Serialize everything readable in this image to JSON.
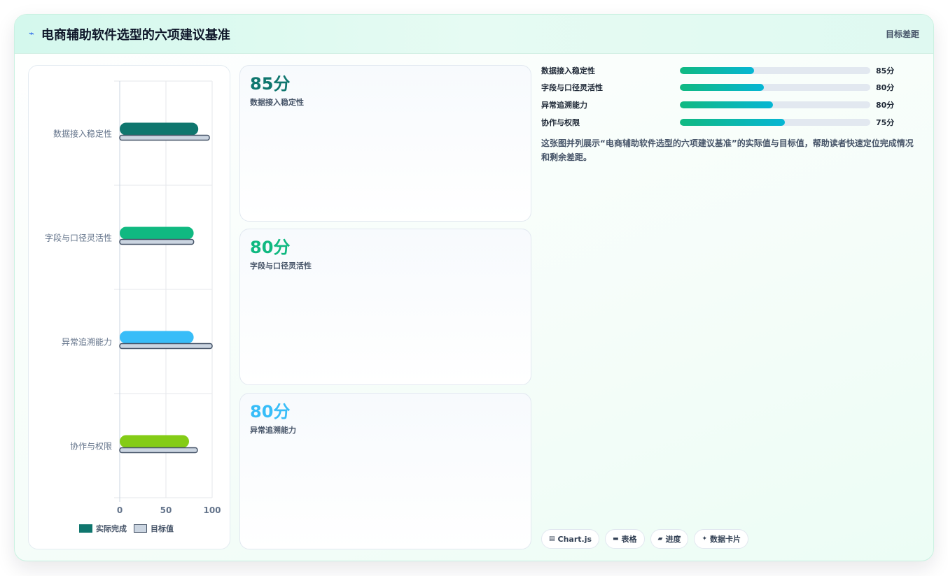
{
  "header": {
    "icon": "lightning-icon",
    "title": "电商辅助软件选型的六项建议基准",
    "tag": "目标差距"
  },
  "chart_data": {
    "type": "bar",
    "orientation": "horizontal",
    "categories": [
      "数据接入稳定性",
      "字段与口径灵活性",
      "异常追溯能力",
      "协作与权限"
    ],
    "series": [
      {
        "name": "实际完成",
        "values": [
          85,
          80,
          80,
          75
        ],
        "colors": [
          "#0f766e",
          "#10b981",
          "#38bdf8",
          "#84cc16"
        ]
      },
      {
        "name": "目标值",
        "values": [
          97,
          80,
          100,
          84
        ],
        "color": "#cbd5e1",
        "border": "#475569"
      }
    ],
    "xlim": [
      0,
      100
    ],
    "xticks": [
      "0",
      "50",
      "100"
    ],
    "grid": true,
    "legend_position": "bottom"
  },
  "kpis": [
    {
      "value": "85分",
      "label": "数据接入稳定性",
      "color": "#0f766e"
    },
    {
      "value": "80分",
      "label": "字段与口径灵活性",
      "color": "#10b981"
    },
    {
      "value": "80分",
      "label": "异常追溯能力",
      "color": "#38bdf8"
    }
  ],
  "progress": [
    {
      "label": "数据接入稳定性",
      "value_text": "85分",
      "fill_percent": 39
    },
    {
      "label": "字段与口径灵活性",
      "value_text": "80分",
      "fill_percent": 44
    },
    {
      "label": "异常追溯能力",
      "value_text": "80分",
      "fill_percent": 49
    },
    {
      "label": "协作与权限",
      "value_text": "75分",
      "fill_percent": 55
    }
  ],
  "description": "这张图并列展示“电商辅助软件选型的六项建议基准”的实际值与目标值，帮助读者快速定位完成情况和剩余差距。",
  "chips": [
    {
      "icon": "chart-icon",
      "glyph": "▤",
      "label": "Chart.js"
    },
    {
      "icon": "table-icon",
      "glyph": "▬",
      "label": "表格"
    },
    {
      "icon": "progress-icon",
      "glyph": "▰",
      "label": "进度"
    },
    {
      "icon": "card-icon",
      "glyph": "✦",
      "label": "数据卡片"
    }
  ]
}
